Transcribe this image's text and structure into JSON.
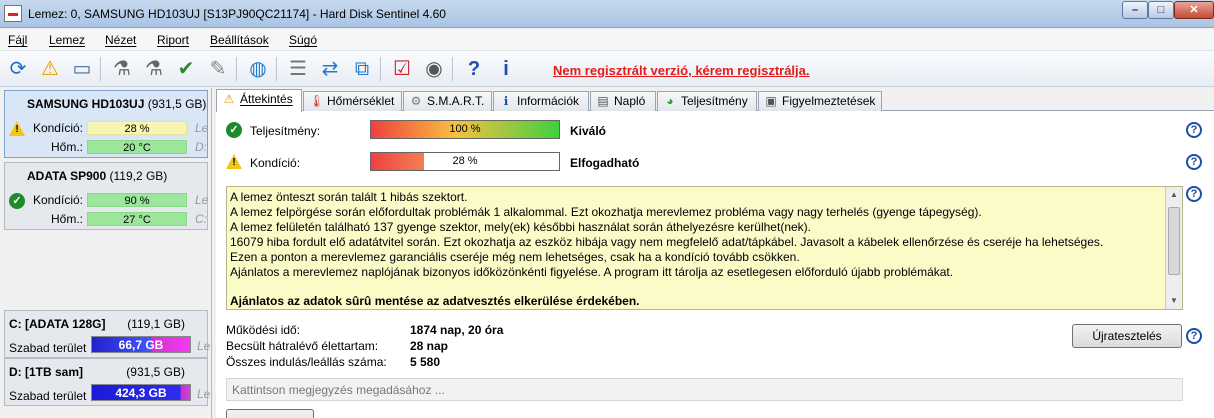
{
  "window": {
    "title": "Lemez: 0, SAMSUNG HD103UJ [S13PJ90QC21174]  -  Hard Disk Sentinel 4.60",
    "minimize": "–",
    "maximize": "□",
    "close": "✕"
  },
  "menu": [
    "Fájl",
    "Lemez",
    "Nézet",
    "Riport",
    "Beállítások",
    "Súgó"
  ],
  "toolbar": {
    "icons": [
      "refresh-icon",
      "warning-refresh-icon",
      "disk-icon",
      "disk-test-icon",
      "disk-test-icon-2",
      "disk-check-icon",
      "disk-wrench-icon",
      "globe-icon",
      "report-icon",
      "sync-icon",
      "network-icon",
      "tasks-icon",
      "speaker-icon",
      "help-icon",
      "info-icon"
    ],
    "register_text": "Nem regisztrált verzió, kérem regisztrálja."
  },
  "disks": [
    {
      "name": "SAMSUNG HD103UJ",
      "size": "(931,5 GB)",
      "condition_label": "Kondíció:",
      "condition_value": "28 %",
      "condition_trail": "Le",
      "temp_label": "Hőm.:",
      "temp_value": "20 °C",
      "temp_trail": "D:",
      "status": "warning"
    },
    {
      "name": "ADATA SP900",
      "size": "(119,2 GB)",
      "condition_label": "Kondíció:",
      "condition_value": "90 %",
      "condition_trail": "Le",
      "temp_label": "Hőm.:",
      "temp_value": "27 °C",
      "temp_trail": "C:",
      "status": "ok"
    }
  ],
  "volumes": [
    {
      "name": "C: [ADATA 128G]",
      "size": "(119,1 GB)",
      "free_label": "Szabad terület",
      "free_value": "66,7 GB",
      "trail": "Le"
    },
    {
      "name": "D: [1TB sam]",
      "size": "(931,5 GB)",
      "free_label": "Szabad terület",
      "free_value": "424,3 GB",
      "trail": "Le"
    }
  ],
  "tabs": [
    {
      "label": "Áttekintés",
      "icon": "warning-icon"
    },
    {
      "label": "Hőmérséklet",
      "icon": "thermometer-icon"
    },
    {
      "label": "S.M.A.R.T.",
      "icon": "smart-icon"
    },
    {
      "label": "Információk",
      "icon": "info-icon"
    },
    {
      "label": "Napló",
      "icon": "log-icon"
    },
    {
      "label": "Teljesítmény",
      "icon": "gauge-icon"
    },
    {
      "label": "Figyelmeztetések",
      "icon": "alerts-icon"
    }
  ],
  "overview": {
    "performance_label": "Teljesítmény:",
    "performance_value": "100 %",
    "performance_fraction": 1.0,
    "performance_verdict": "Kiváló",
    "condition_label": "Kondíció:",
    "condition_value": "28 %",
    "condition_fraction": 0.28,
    "condition_verdict": "Elfogadható",
    "notes": [
      "A lemez önteszt során talált 1 hibás szektort.",
      "A lemez felpörgése során előfordultak problémák 1 alkalommal. Ezt okozhatja merevlemez probléma vagy nagy terhelés (gyenge tápegység).",
      "A lemez felületén található 137 gyenge szektor, mely(ek) későbbi használat során áthelyezésre kerülhet(nek).",
      "16079 hiba fordult elő adatátvitel során. Ezt okozhatja az eszköz hibája vagy nem megfelelő adat/tápkábel. Javasolt a kábelek ellenőrzése és cseréje ha lehetséges.",
      "Ezen a ponton a merevlemez garanciális cseréje még nem lehetséges, csak ha a kondíció tovább csökken.",
      "Ajánlatos a merevlemez naplójának bizonyos időközönkénti figyelése. A program itt tárolja az esetlegesen előforduló újabb problémákat."
    ],
    "note_bold": "Ajánlatos az adatok sûrû mentése az adatvesztés elkerülése érdekében.",
    "power_on_label": "Működési idő:",
    "power_on_value": "1874 nap, 20 óra",
    "remaining_label": "Becsült hátralévő élettartam:",
    "remaining_value": "28 nap",
    "starts_label": "Összes indulás/leállás száma:",
    "starts_value": "5 580",
    "retest_button": "Újratesztelés",
    "comment_placeholder": "Kattintson megjegyzés megadásához ..."
  },
  "colors": {
    "ok": "#1f8a2a",
    "warning": "#f2c51a",
    "register_link": "#e31b1b",
    "notes_bg": "#fbfbc8"
  }
}
